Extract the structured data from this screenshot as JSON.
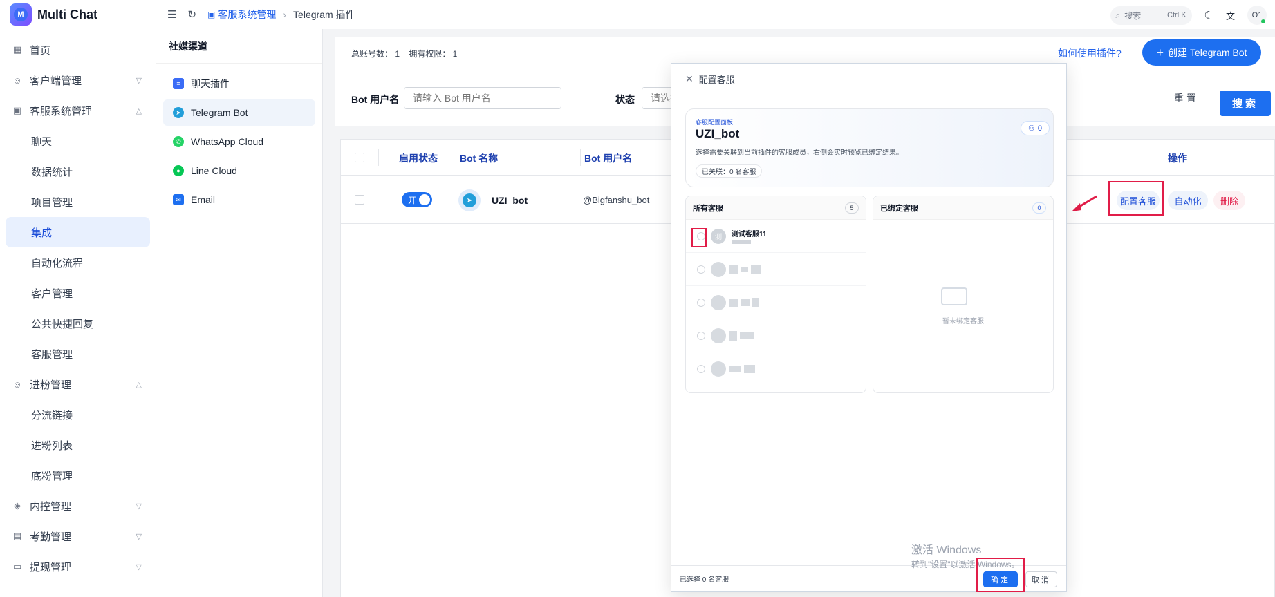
{
  "app": {
    "title": "Multi Chat",
    "logo_letter": "M"
  },
  "sidebar": {
    "items": [
      {
        "label": "首页",
        "icon": "grid-icon"
      },
      {
        "label": "客户端管理",
        "icon": "user-icon"
      },
      {
        "label": "客服系统管理",
        "icon": "robot-icon"
      },
      {
        "label": "进粉管理",
        "icon": "user-plus-icon"
      },
      {
        "label": "内控管理",
        "icon": "shield-icon"
      },
      {
        "label": "考勤管理",
        "icon": "calendar-icon"
      },
      {
        "label": "提现管理",
        "icon": "wallet-icon"
      }
    ],
    "sub_kefu": [
      "聊天",
      "数据统计",
      "项目管理",
      "集成",
      "自动化流程",
      "客户管理",
      "公共快捷回复",
      "客服管理"
    ],
    "sub_jinfen": [
      "分流链接",
      "进粉列表",
      "底粉管理"
    ],
    "active": "集成"
  },
  "topbar": {
    "breadcrumb_parent": "客服系统管理",
    "breadcrumb_current": "Telegram 插件",
    "search_placeholder": "搜索",
    "search_shortcut": "Ctrl K",
    "user_initials": "O1"
  },
  "channels": {
    "title": "社媒渠道",
    "items": [
      {
        "label": "聊天插件",
        "color": "#3b6cf6",
        "glyph": "≡"
      },
      {
        "label": "Telegram Bot",
        "color": "#229ed9",
        "glyph": "➤"
      },
      {
        "label": "WhatsApp Cloud",
        "color": "#25d366",
        "glyph": "✆"
      },
      {
        "label": "Line Cloud",
        "color": "#06c755",
        "glyph": "●"
      },
      {
        "label": "Email",
        "color": "#1d6ff0",
        "glyph": "✉"
      }
    ],
    "active": "Telegram Bot"
  },
  "main": {
    "stats": "总账号数： 1    拥有权限： 1",
    "how_link": "如何使用插件?",
    "create_button": "创建 Telegram Bot",
    "filter_username_label": "Bot 用户名",
    "filter_username_placeholder": "请输入 Bot 用户名",
    "filter_status_label": "状态",
    "filter_status_placeholder": "请选择",
    "reset_button": "重置",
    "search_button": "搜索",
    "table": {
      "headers": {
        "status": "启用状态",
        "name": "Bot 名称",
        "username": "Bot 用户名",
        "ops": "操作"
      },
      "row": {
        "toggle_label": "开",
        "name": "UZI_bot",
        "username": "@Bigfanshu_bot",
        "ops": [
          "配置客服",
          "自动化",
          "删除"
        ]
      }
    }
  },
  "dialog": {
    "title": "配置客服",
    "hero_tag": "客服配置面板",
    "hero_title": "UZI_bot",
    "hero_desc": "选择需要关联到当前插件的客服成员，右侧会实时预览已绑定结果。",
    "hero_chip": "已关联：0 名客服",
    "hero_count": "0",
    "all_agents_title": "所有客服",
    "all_agents_count": "5",
    "bound_title": "已绑定客服",
    "bound_count": "0",
    "first_agent_name": "测试客服11",
    "first_agent_initial": "测",
    "empty_text": "暂未绑定客服",
    "footer_text": "已选择 0 名客服",
    "ok_button": "确定",
    "cancel_button": "取消"
  },
  "watermark": {
    "line1": "激活 Windows",
    "line2": "转到\"设置\"以激活 Windows。"
  },
  "colors": {
    "primary": "#1d6ff0",
    "danger": "#e11d48",
    "active_bg": "#e8f0fe"
  }
}
